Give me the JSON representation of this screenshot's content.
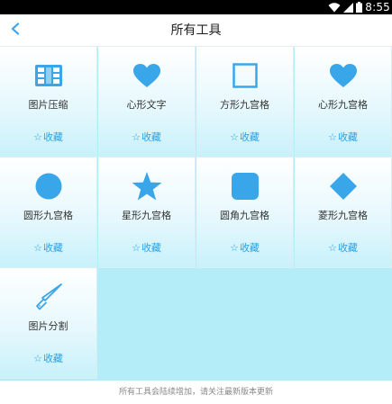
{
  "status_bar": {
    "time": "8:55",
    "icons": [
      "wifi-icon",
      "signal-icon",
      "battery-icon"
    ]
  },
  "header": {
    "title": "所有工具",
    "back_icon": "chevron-left-icon"
  },
  "tools": [
    {
      "name": "图片压缩",
      "fav": "收藏",
      "icon": "grid-compress-icon"
    },
    {
      "name": "心形文字",
      "fav": "收藏",
      "icon": "heart-icon"
    },
    {
      "name": "方形九宫格",
      "fav": "收藏",
      "icon": "square-outline-icon"
    },
    {
      "name": "心形九宫格",
      "fav": "收藏",
      "icon": "heart-icon"
    },
    {
      "name": "圆形九宫格",
      "fav": "收藏",
      "icon": "circle-icon"
    },
    {
      "name": "星形九宫格",
      "fav": "收藏",
      "icon": "star-icon"
    },
    {
      "name": "圆角九宫格",
      "fav": "收藏",
      "icon": "rounded-square-icon"
    },
    {
      "name": "菱形九宫格",
      "fav": "收藏",
      "icon": "diamond-icon"
    },
    {
      "name": "图片分割",
      "fav": "收藏",
      "icon": "knife-icon"
    }
  ],
  "footer": {
    "text": "所有工具会陆续增加，请关注最新版本更新"
  },
  "colors": {
    "accent": "#3aa6ea",
    "grid_bg": "#b4ecf7"
  }
}
